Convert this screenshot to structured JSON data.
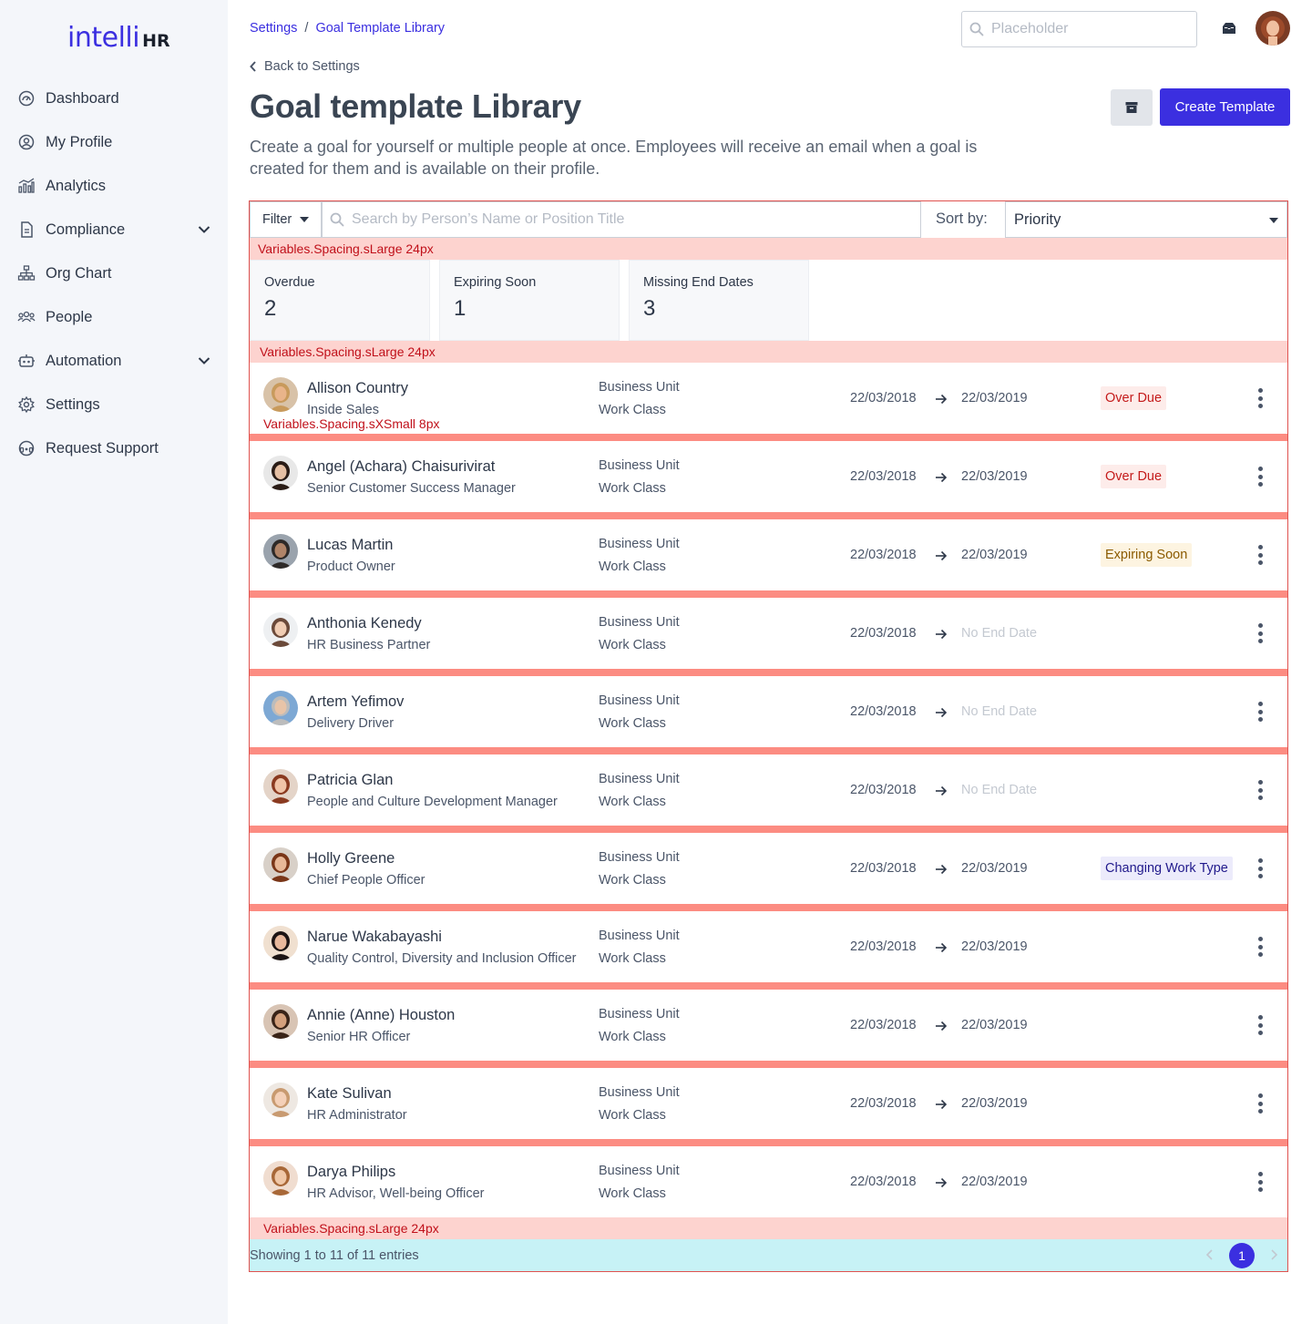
{
  "brand": {
    "logo_main": "intelli",
    "logo_sub": "HR"
  },
  "sidebar": {
    "items": [
      {
        "label": "Dashboard",
        "icon": "dashboard-icon"
      },
      {
        "label": "My Profile",
        "icon": "profile-icon"
      },
      {
        "label": "Analytics",
        "icon": "analytics-icon"
      },
      {
        "label": "Compliance",
        "icon": "compliance-icon",
        "expandable": true
      },
      {
        "label": "Org Chart",
        "icon": "org-chart-icon"
      },
      {
        "label": "People",
        "icon": "people-icon"
      },
      {
        "label": "Automation",
        "icon": "automation-icon",
        "expandable": true
      },
      {
        "label": "Settings",
        "icon": "settings-icon"
      },
      {
        "label": "Request Support",
        "icon": "support-icon"
      }
    ]
  },
  "header": {
    "breadcrumb": [
      "Settings",
      "Goal Template Library"
    ],
    "breadcrumb_sep": "/",
    "search_placeholder": "Placeholder",
    "back_label": "Back to Settings",
    "title": "Goal template Library",
    "description": "Create a goal for yourself or multiple people at once. Employees will receive an email when a goal is created for them and is available on their profile.",
    "create_button": "Create Template"
  },
  "toolbar": {
    "filter_label": "Filter",
    "search_placeholder": "Search by Person’s Name or Position Title",
    "sort_label": "Sort by:",
    "sort_value": "Priority"
  },
  "annotations": {
    "large_spacing": "Variables.Spacing.sLarge 24px",
    "xsmall_spacing": "Variables.Spacing.sXSmall 8px"
  },
  "stats": [
    {
      "label": "Overdue",
      "value": "2"
    },
    {
      "label": "Expiring Soon",
      "value": "1"
    },
    {
      "label": "Missing End Dates",
      "value": "3"
    }
  ],
  "rows": [
    {
      "name": "Allison Country",
      "title": "Inside Sales",
      "bu": "Business Unit",
      "wc": "Work Class",
      "start": "22/03/2018",
      "end": "22/03/2019",
      "end_missing": false,
      "badge": "Over Due",
      "badge_type": "overdue"
    },
    {
      "name": "Angel (Achara) Chaisurivirat",
      "title": "Senior Customer Success Manager",
      "bu": "Business Unit",
      "wc": "Work Class",
      "start": "22/03/2018",
      "end": "22/03/2019",
      "end_missing": false,
      "badge": "Over Due",
      "badge_type": "overdue"
    },
    {
      "name": "Lucas Martin",
      "title": "Product Owner",
      "bu": "Business Unit",
      "wc": "Work Class",
      "start": "22/03/2018",
      "end": "22/03/2019",
      "end_missing": false,
      "badge": "Expiring Soon",
      "badge_type": "expiring"
    },
    {
      "name": "Anthonia Kenedy",
      "title": "HR Business Partner",
      "bu": "Business Unit",
      "wc": "Work Class",
      "start": "22/03/2018",
      "end": "No End Date",
      "end_missing": true,
      "badge": "",
      "badge_type": ""
    },
    {
      "name": "Artem Yefimov",
      "title": "Delivery Driver",
      "bu": "Business Unit",
      "wc": "Work Class",
      "start": "22/03/2018",
      "end": "No End Date",
      "end_missing": true,
      "badge": "",
      "badge_type": ""
    },
    {
      "name": "Patricia Glan",
      "title": "People and Culture Development Manager",
      "bu": "Business Unit",
      "wc": "Work Class",
      "start": "22/03/2018",
      "end": "No End Date",
      "end_missing": true,
      "badge": "",
      "badge_type": ""
    },
    {
      "name": "Holly Greene",
      "title": "Chief People Officer",
      "bu": "Business Unit",
      "wc": "Work Class",
      "start": "22/03/2018",
      "end": "22/03/2019",
      "end_missing": false,
      "badge": "Changing Work Type",
      "badge_type": "changing"
    },
    {
      "name": "Narue Wakabayashi",
      "title": "Quality Control, Diversity and Inclusion Officer",
      "bu": "Business Unit",
      "wc": "Work Class",
      "start": "22/03/2018",
      "end": "22/03/2019",
      "end_missing": false,
      "badge": "",
      "badge_type": ""
    },
    {
      "name": "Annie (Anne) Houston",
      "title": "Senior HR Officer",
      "bu": "Business Unit",
      "wc": "Work Class",
      "start": "22/03/2018",
      "end": "22/03/2019",
      "end_missing": false,
      "badge": "",
      "badge_type": ""
    },
    {
      "name": "Kate Sulivan",
      "title": "HR Administrator",
      "bu": "Business Unit",
      "wc": "Work Class",
      "start": "22/03/2018",
      "end": "22/03/2019",
      "end_missing": false,
      "badge": "",
      "badge_type": ""
    },
    {
      "name": "Darya Philips",
      "title": "HR Advisor, Well-being Officer",
      "bu": "Business Unit",
      "wc": "Work Class",
      "start": "22/03/2018",
      "end": "22/03/2019",
      "end_missing": false,
      "badge": "",
      "badge_type": ""
    }
  ],
  "footer": {
    "info": "Showing 1 to 11 of 11 entries",
    "current_page": "1"
  },
  "colors": {
    "accent": "#3b2fe0",
    "row_divider": "#fc8c82",
    "spacing_annotation": "#fdd3cf",
    "footer_bg": "#c7f2f6"
  }
}
